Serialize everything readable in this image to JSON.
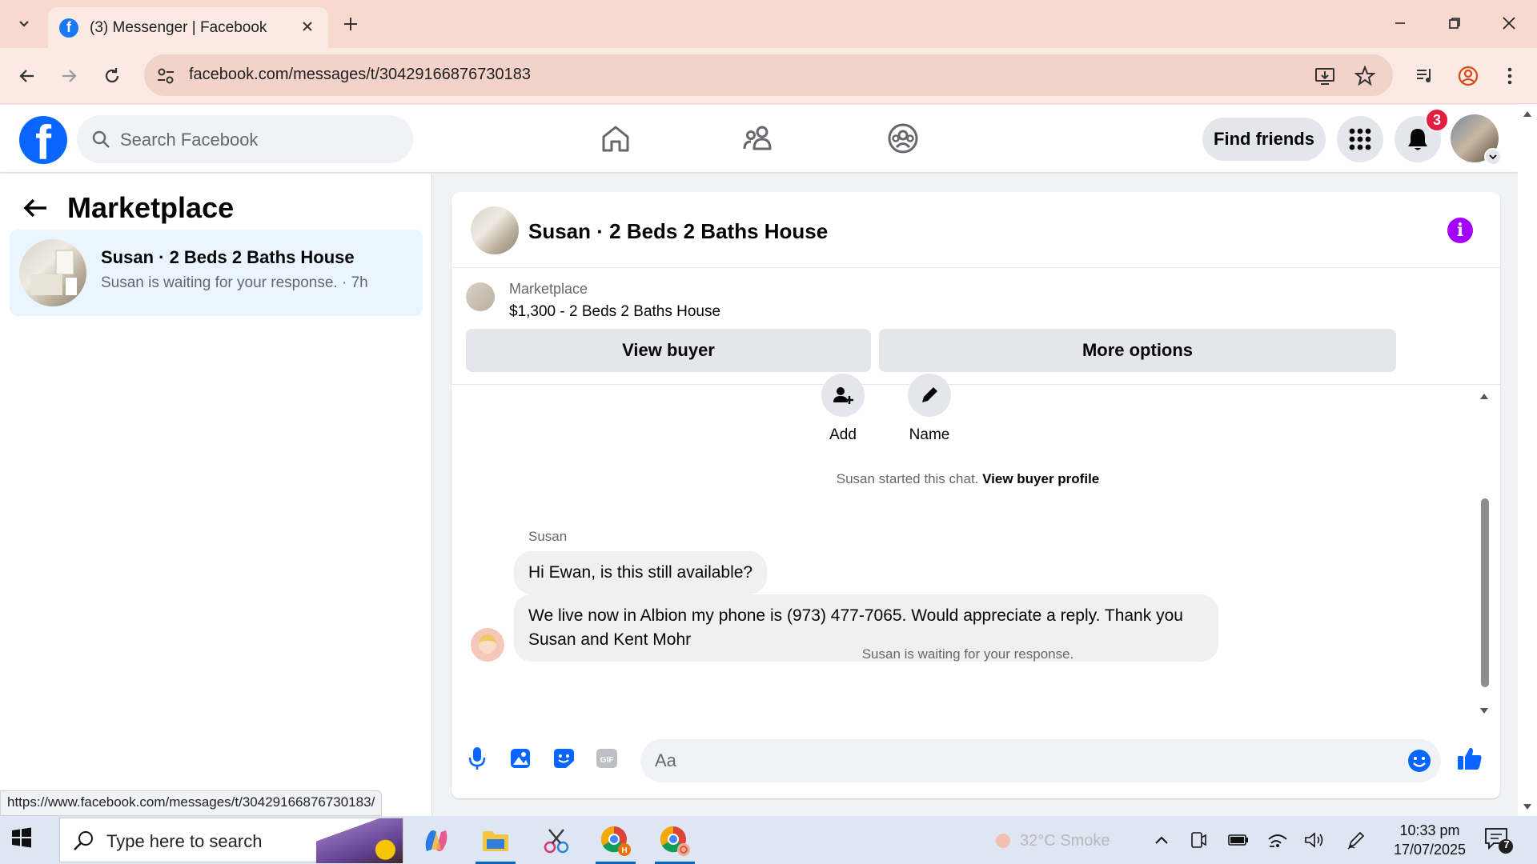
{
  "browser": {
    "tab_title": "(3) Messenger | Facebook",
    "url": "facebook.com/messages/t/30429166876730183",
    "status_url": "https://www.facebook.com/messages/t/30429166876730183/"
  },
  "fb_header": {
    "search_placeholder": "Search Facebook",
    "find_friends_label": "Find friends",
    "notification_count": "3"
  },
  "left_pane": {
    "title": "Marketplace",
    "conversation": {
      "name": "Susan · 2 Beds 2 Baths House",
      "subtitle": "Susan is waiting for your response. · 7h"
    }
  },
  "chat": {
    "header_name": "Susan · 2 Beds 2 Baths House",
    "marketplace_label": "Marketplace",
    "listing": "$1,300 - 2 Beds 2 Baths House",
    "view_buyer_label": "View buyer",
    "more_options_label": "More options",
    "actions": [
      {
        "label": "Add",
        "icon": "add-person-icon"
      },
      {
        "label": "Name",
        "icon": "pencil-icon"
      }
    ],
    "started_text": "Susan started this chat.",
    "view_buyer_profile": "View buyer profile",
    "sender_name": "Susan",
    "messages": [
      "Hi Ewan, is this still available?",
      "We live now in Albion  my phone is (973) 477-7065. Would appreciate a reply. Thank you Susan and Kent Mohr"
    ],
    "waiting_text": "Susan is waiting for your response.",
    "composer_placeholder": "Aa"
  },
  "taskbar": {
    "search_placeholder": "Type here to search",
    "weather": "32°C  Smoke",
    "time": "10:33 pm",
    "date": "17/07/2025",
    "notification_count": "7"
  },
  "colors": {
    "fb_blue": "#0866ff",
    "accent_purple": "#a200ff",
    "notif_red": "#e41e3f",
    "selected_conv_bg": "#ebf5ff"
  }
}
